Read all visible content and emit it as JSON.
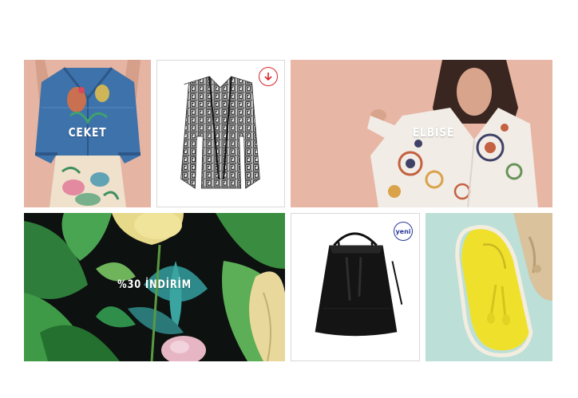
{
  "tiles": {
    "jacket": {
      "label": "CEKET",
      "icon": "denim-jacket-image"
    },
    "cardigan": {
      "icon": "patterned-cardigan-image",
      "badge_icon": "arrow-down-circle-icon",
      "badge_color": "#d6232a"
    },
    "dress": {
      "label": "ELBİSE",
      "icon": "embroidered-dress-image"
    },
    "sale": {
      "label": "%30 İNDİRİM",
      "icon": "tropical-leaves-image"
    },
    "bag": {
      "badge": "yeni",
      "icon": "black-bucket-bag-image",
      "badge_color": "#2a3a9c"
    },
    "shoes": {
      "icon": "yellow-loafers-image"
    }
  },
  "colors": {
    "peach_background": "#e7b8a6",
    "mint_background": "#b9ded6",
    "tile_border": "#d9d9d9"
  }
}
